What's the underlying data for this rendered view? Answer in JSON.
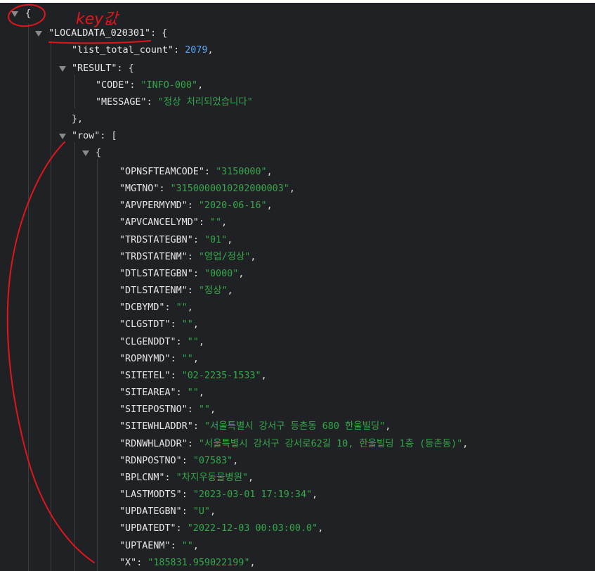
{
  "annotation": {
    "note_text": "key값"
  },
  "json_tree": {
    "root_open": "{",
    "key_localdata": "\"LOCALDATA_020301\"",
    "colon_open_brace": ": {",
    "key_list_total_count": "\"list_total_count\"",
    "colon": ": ",
    "list_total_count": "2079",
    "comma": ",",
    "key_result": "\"RESULT\"",
    "key_code": "\"CODE\"",
    "code_value": "\"INFO-000\"",
    "key_message": "\"MESSAGE\"",
    "message_value": "\"정상 처리되었습니다\"",
    "close_brace_comma": "},",
    "key_row": "\"row\"",
    "colon_open_bracket": ": [",
    "row_open": "{",
    "fields": [
      {
        "key": "\"OPNSFTEAMCODE\"",
        "value": "\"3150000\""
      },
      {
        "key": "\"MGTNO\"",
        "value": "\"3150000010202000003\""
      },
      {
        "key": "\"APVPERMYMD\"",
        "value": "\"2020-06-16\""
      },
      {
        "key": "\"APVCANCELYMD\"",
        "value": "\"\""
      },
      {
        "key": "\"TRDSTATEGBN\"",
        "value": "\"01\""
      },
      {
        "key": "\"TRDSTATENM\"",
        "value": "\"영업/정상\""
      },
      {
        "key": "\"DTLSTATEGBN\"",
        "value": "\"0000\""
      },
      {
        "key": "\"DTLSTATENM\"",
        "value": "\"정상\""
      },
      {
        "key": "\"DCBYMD\"",
        "value": "\"\""
      },
      {
        "key": "\"CLGSTDT\"",
        "value": "\"\""
      },
      {
        "key": "\"CLGENDDT\"",
        "value": "\"\""
      },
      {
        "key": "\"ROPNYMD\"",
        "value": "\"\""
      },
      {
        "key": "\"SITETEL\"",
        "value": "\"02-2235-1533\""
      },
      {
        "key": "\"SITEAREA\"",
        "value": "\"\""
      },
      {
        "key": "\"SITEPOSTNO\"",
        "value": "\"\""
      },
      {
        "key": "\"SITEWHLADDR\"",
        "value": "\"서울특별시 강서구 등촌동 680 한울빌딩\""
      },
      {
        "key": "\"RDNWHLADDR\"",
        "value": "\"서울특별시 강서구 강서로62길 10, 한울빌딩 1층 (등촌동)\""
      },
      {
        "key": "\"RDNPOSTNO\"",
        "value": "\"07583\""
      },
      {
        "key": "\"BPLCNM\"",
        "value": "\"차지우동물병원\""
      },
      {
        "key": "\"LASTMODTS\"",
        "value": "\"2023-03-01 17:19:34\""
      },
      {
        "key": "\"UPDATEGBN\"",
        "value": "\"U\""
      },
      {
        "key": "\"UPDATEDT\"",
        "value": "\"2022-12-03 00:03:00.0\""
      },
      {
        "key": "\"UPTAENM\"",
        "value": "\"\""
      },
      {
        "key": "\"X\"",
        "value": "\"185831.959022199\""
      }
    ]
  },
  "colors": {
    "background": "#202124",
    "key": "#e6e6e6",
    "string": "#34a84a",
    "number": "#5aa5f2",
    "annotation": "#e0161c"
  }
}
